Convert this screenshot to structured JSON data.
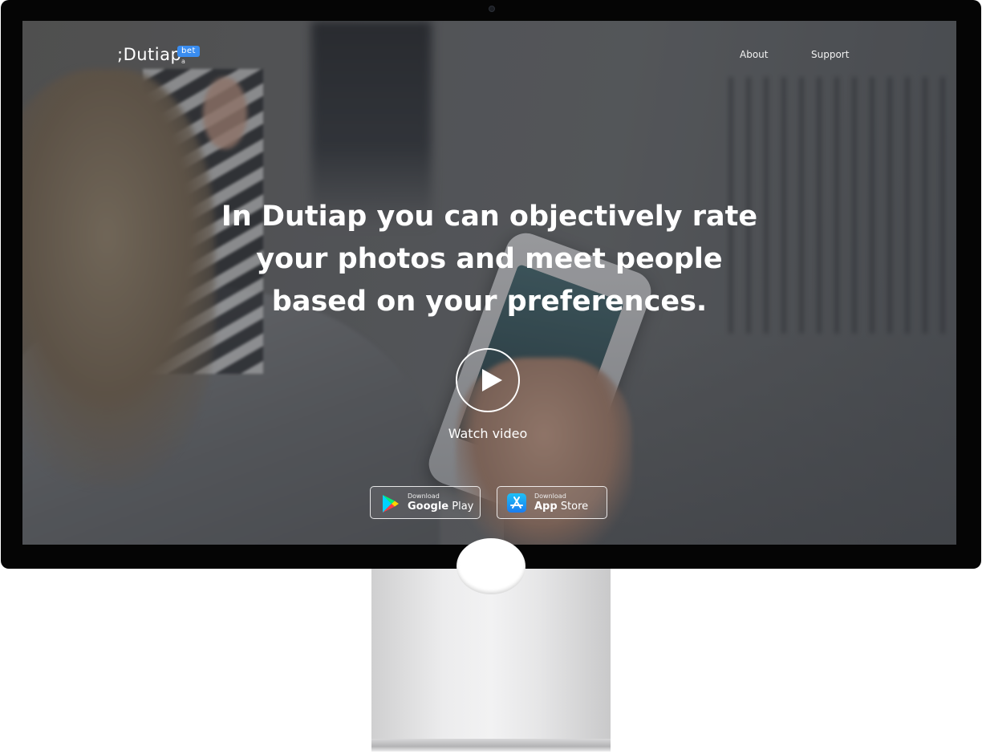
{
  "brand": {
    "name": ";Dutiap",
    "badge": "bet",
    "badge_suffix": "a",
    "badge_color": "#3a8df0"
  },
  "nav": {
    "items": [
      {
        "label": "About"
      },
      {
        "label": "Support"
      }
    ]
  },
  "hero": {
    "headline": "In Dutiap you can objectively rate your photos and meet people based on your preferences.",
    "video_label": "Watch video",
    "play_icon": "play-icon"
  },
  "stores": {
    "google": {
      "small": "Download",
      "brand": "Google",
      "suffix": " Play",
      "icon": "google-play-icon"
    },
    "apple": {
      "small": "Download",
      "brand": "App",
      "suffix": " Store",
      "icon": "app-store-icon"
    }
  },
  "colors": {
    "overlay": "#1c2026",
    "text": "#ffffff",
    "bezel": "#050505"
  }
}
